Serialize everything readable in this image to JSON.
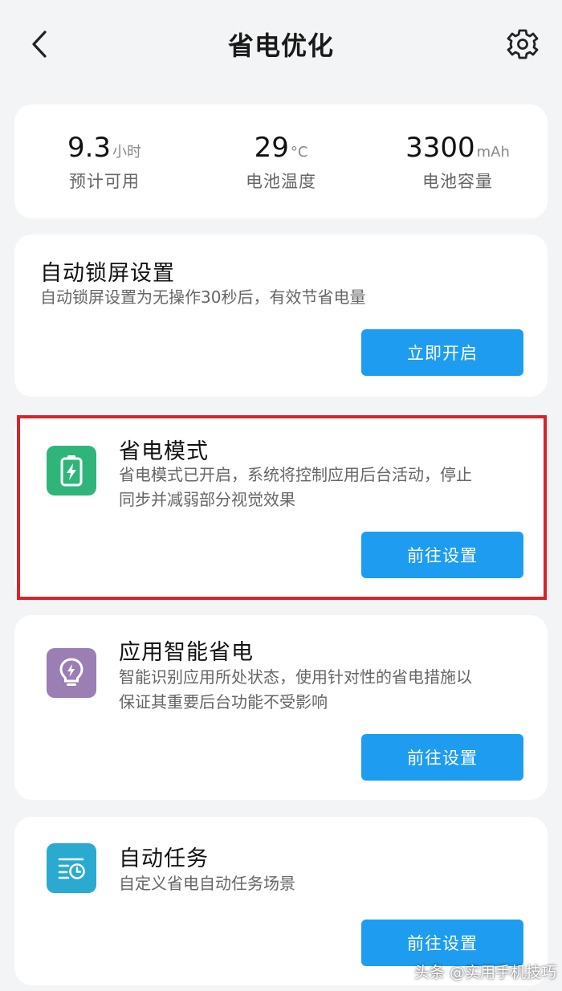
{
  "header": {
    "title": "省电优化",
    "back_icon": "chevron-left-icon",
    "settings_icon": "gear-icon"
  },
  "stats": [
    {
      "value": "9.3",
      "unit": "小时",
      "label": "预计可用"
    },
    {
      "value": "29",
      "unit": "°C",
      "label": "电池温度"
    },
    {
      "value": "3300",
      "unit": "mAh",
      "label": "电池容量"
    }
  ],
  "cards": {
    "auto_lock": {
      "title": "自动锁屏设置",
      "desc": "自动锁屏设置为无操作30秒后，有效节省电量",
      "button": "立即开启"
    },
    "power_saving": {
      "title": "省电模式",
      "desc_line1": "省电模式已开启，系统将控制应用后台活动，停止",
      "desc_line2": "同步并减弱部分视觉效果",
      "button": "前往设置",
      "icon": "battery-bolt-icon",
      "icon_color": "#2fb57a"
    },
    "app_smart": {
      "title": "应用智能省电",
      "desc_line1": "智能识别应用所处状态，使用针对性的省电措施以",
      "desc_line2": "保证其重要后台功能不受影响",
      "button": "前往设置",
      "icon": "lightbulb-bolt-icon",
      "icon_color": "#9b7eb3"
    },
    "auto_task": {
      "title": "自动任务",
      "desc": "自定义省电自动任务场景",
      "button": "前往设置",
      "icon": "list-clock-icon",
      "icon_color": "#2aaad0"
    }
  },
  "colors": {
    "accent": "#1e9df0",
    "highlight": "#d7242a",
    "background": "#f3f4f6"
  },
  "watermark": "头条 @实用手机技巧"
}
